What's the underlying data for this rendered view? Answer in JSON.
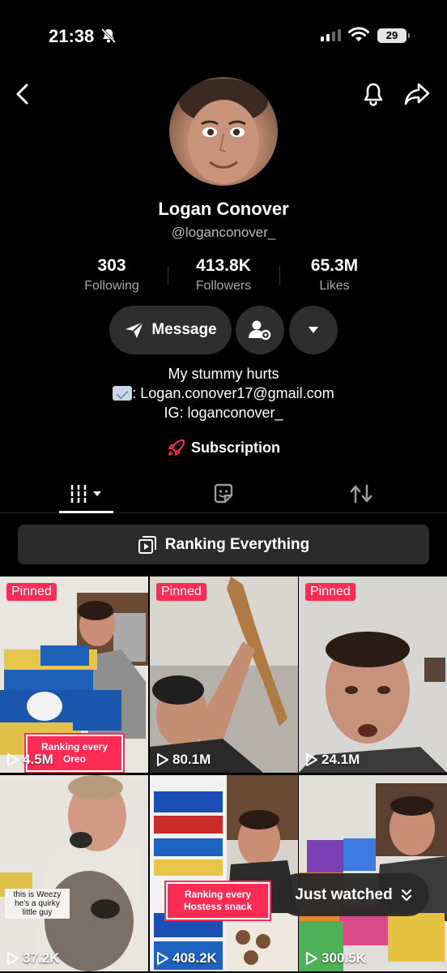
{
  "status_bar": {
    "time": "21:38",
    "battery": "29"
  },
  "profile": {
    "name": "Logan Conover",
    "handle": "@loganconover_",
    "stats": [
      {
        "value": "303",
        "label": "Following"
      },
      {
        "value": "413.8K",
        "label": "Followers"
      },
      {
        "value": "65.3M",
        "label": "Likes"
      }
    ],
    "message_button": "Message",
    "bio_line1": "My stummy hurts",
    "bio_email": ": Logan.conover17@gmail.com",
    "bio_ig": "IG: loganconover_",
    "subscription": "Subscription"
  },
  "playlist": {
    "label": "Ranking Everything"
  },
  "videos": [
    {
      "pinned": "Pinned",
      "views": "4.5M",
      "overlay": "Ranking every Oreo"
    },
    {
      "pinned": "Pinned",
      "views": "80.1M"
    },
    {
      "pinned": "Pinned",
      "views": "24.1M"
    },
    {
      "views": "37.2K",
      "caption": "this is Weezy he's a quirky little guy"
    },
    {
      "views": "408.2K",
      "overlay": "Ranking every Hostess snack"
    },
    {
      "views": "300.5K"
    }
  ],
  "just_watched": "Just watched",
  "colors": {
    "accent": "#fe2c55",
    "surface": "#2e2e2e",
    "background": "#000000"
  }
}
